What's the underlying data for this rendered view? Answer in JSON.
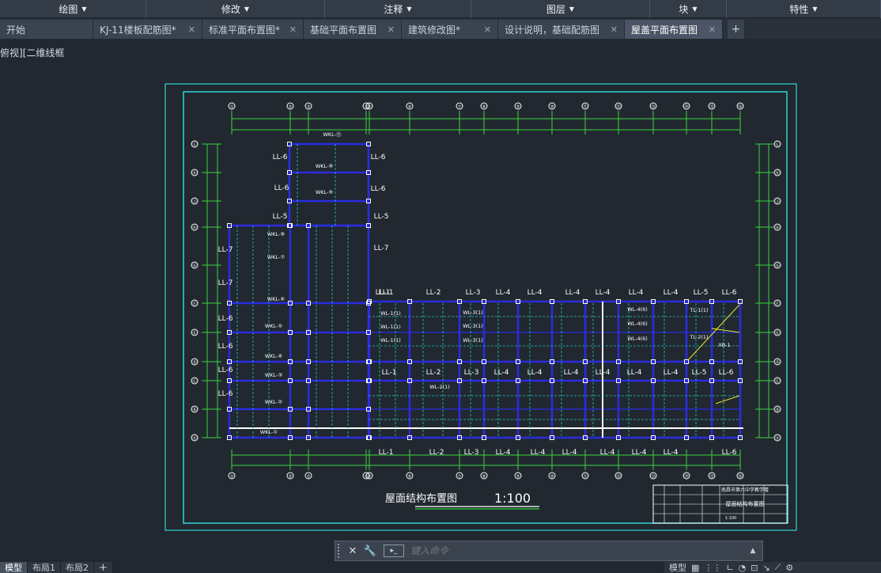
{
  "ribbon": {
    "panels": [
      {
        "label": "绘图",
        "width": 185
      },
      {
        "label": "修改",
        "width": 226
      },
      {
        "label": "注释",
        "width": 185
      },
      {
        "label": "图层",
        "width": 226
      },
      {
        "label": "块",
        "width": 97
      },
      {
        "label": "特性",
        "width": 195
      }
    ]
  },
  "tabs": [
    {
      "label": "开始",
      "closable": false,
      "width": 118
    },
    {
      "label": "KJ-11楼板配筋图*",
      "closable": true,
      "width": 138
    },
    {
      "label": "标准平面布置图*",
      "closable": true,
      "width": 128
    },
    {
      "label": "基础平面布置图",
      "closable": true,
      "width": 124
    },
    {
      "label": "建筑修改图*",
      "closable": true,
      "width": 122
    },
    {
      "label": "设计说明，基础配筋图",
      "closable": true,
      "width": 160
    },
    {
      "label": "屋盖平面布置图",
      "closable": true,
      "width": 124,
      "active": true
    }
  ],
  "viewport": {
    "label": "俯视][二维线框"
  },
  "drawing": {
    "title": "屋面结构布置图",
    "scale": "1:100",
    "title_block": {
      "project": "南昌市第六中学教学楼",
      "sheet": "屋面结构布置图",
      "scale": "1:100"
    },
    "grid_top": [
      "①",
      "②",
      "③",
      "④",
      "⑤",
      "⑥",
      "⑦",
      "⑧",
      "⑨",
      "⑩",
      "⑪",
      "⑫",
      "⑬",
      "⑭",
      "⑮",
      "⑯"
    ],
    "grid_side": [
      "Ⓛ",
      "Ⓚ",
      "Ⓙ",
      "Ⓗ",
      "Ⓖ",
      "Ⓕ",
      "Ⓔ",
      "Ⓓ",
      "Ⓒ",
      "Ⓑ",
      "Ⓐ"
    ],
    "beam_labels_top": [
      "LL-1",
      "LL-2",
      "LL-3",
      "LL-4",
      "LL-4",
      "LL-4",
      "LL-4",
      "LL-4",
      "LL-4",
      "LL-5",
      "LL-6"
    ],
    "beam_labels_mid": [
      "LL-1",
      "LL-2",
      "LL-3",
      "LL-4",
      "LL-4",
      "LL-4",
      "LL-4",
      "LL-4",
      "LL-4",
      "LL-5",
      "LL-6"
    ],
    "beam_labels_bottom": [
      "LL-1",
      "LL-2",
      "LL-3",
      "LL-4",
      "LL-4",
      "LL-4",
      "LL-4",
      "LL-4",
      "LL-4",
      "LL-6"
    ],
    "left_labels": [
      "LL-6",
      "LL-6",
      "LL-5",
      "LL-7",
      "LL-7",
      "LL-6",
      "LL-6",
      "LL-6",
      "LL-6"
    ],
    "wing_right_labels": [
      "LL-6",
      "LL-6",
      "LL-5",
      "LL-7",
      "LL-1"
    ],
    "wkl_labels": [
      "WKL-⑪",
      "WKL-⑩",
      "WKL-⑨",
      "WKL-⑧",
      "WKL-⑦",
      "WKL-⑥",
      "WKL-⑤",
      "WKL-④",
      "WKL-③",
      "WKL-②",
      "WKL-①"
    ],
    "wl_labels": [
      "WL-1(1)",
      "WL-1(1)",
      "WL-1(1)",
      "WL-2(1)",
      "WL-3(1)",
      "WL-3(1)",
      "WL-3(1)",
      "WL-4(6)",
      "WL-4(6)",
      "WL-4(6)",
      "TL-1(1)",
      "TL-2(1)",
      "XB-1"
    ]
  },
  "command": {
    "placeholder": "键入命令"
  },
  "layouts": [
    {
      "label": "模型",
      "active": true
    },
    {
      "label": "布局1"
    },
    {
      "label": "布局2"
    }
  ],
  "status": {
    "mode": "模型"
  }
}
